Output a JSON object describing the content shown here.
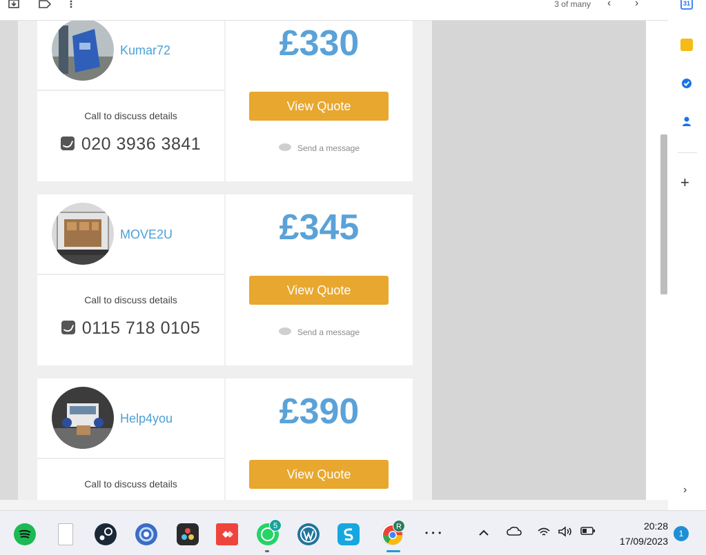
{
  "toolbar": {
    "pager_text": "3 of many",
    "prev_icon": "chevron-left-icon",
    "next_icon": "chevron-right-icon",
    "archive_icon": "download-archive-icon",
    "label_icon": "label-icon",
    "more_icon": "more-vert-icon"
  },
  "quotes": [
    {
      "company": "Kumar72",
      "price": "£330",
      "call_label": "Call to discuss details",
      "phone": "020 3936 3841",
      "button_label": "View Quote",
      "message_label": "Send a message"
    },
    {
      "company": "MOVE2U",
      "price": "£345",
      "call_label": "Call to discuss details",
      "phone": "0115 718 0105",
      "button_label": "View Quote",
      "message_label": "Send a message"
    },
    {
      "company": "Help4you",
      "price": "£390",
      "call_label": "Call to discuss details",
      "phone": "",
      "button_label": "View Quote",
      "message_label": ""
    }
  ],
  "side_panel": {
    "calendar_day": "31",
    "icons": [
      "calendar-icon",
      "keep-icon",
      "tasks-icon",
      "contacts-icon",
      "plus-icon",
      "chevron-right-icon"
    ]
  },
  "taskbar": {
    "apps": [
      "spotify-icon",
      "file-icon",
      "steam-icon",
      "browser-icon",
      "davinci-icon",
      "anydesk-icon",
      "whatsapp-icon",
      "wordpress-icon",
      "app-s-icon",
      "chrome-icon"
    ],
    "whatsapp_badge": "5",
    "chrome_badge": "R",
    "more": "• • •",
    "clock_time": "20:28",
    "clock_date": "17/09/2023",
    "notification_count": "1"
  },
  "colors": {
    "price_blue": "#5aa2d8",
    "company_blue": "#4ba0d8",
    "button_orange": "#e8a72e"
  }
}
